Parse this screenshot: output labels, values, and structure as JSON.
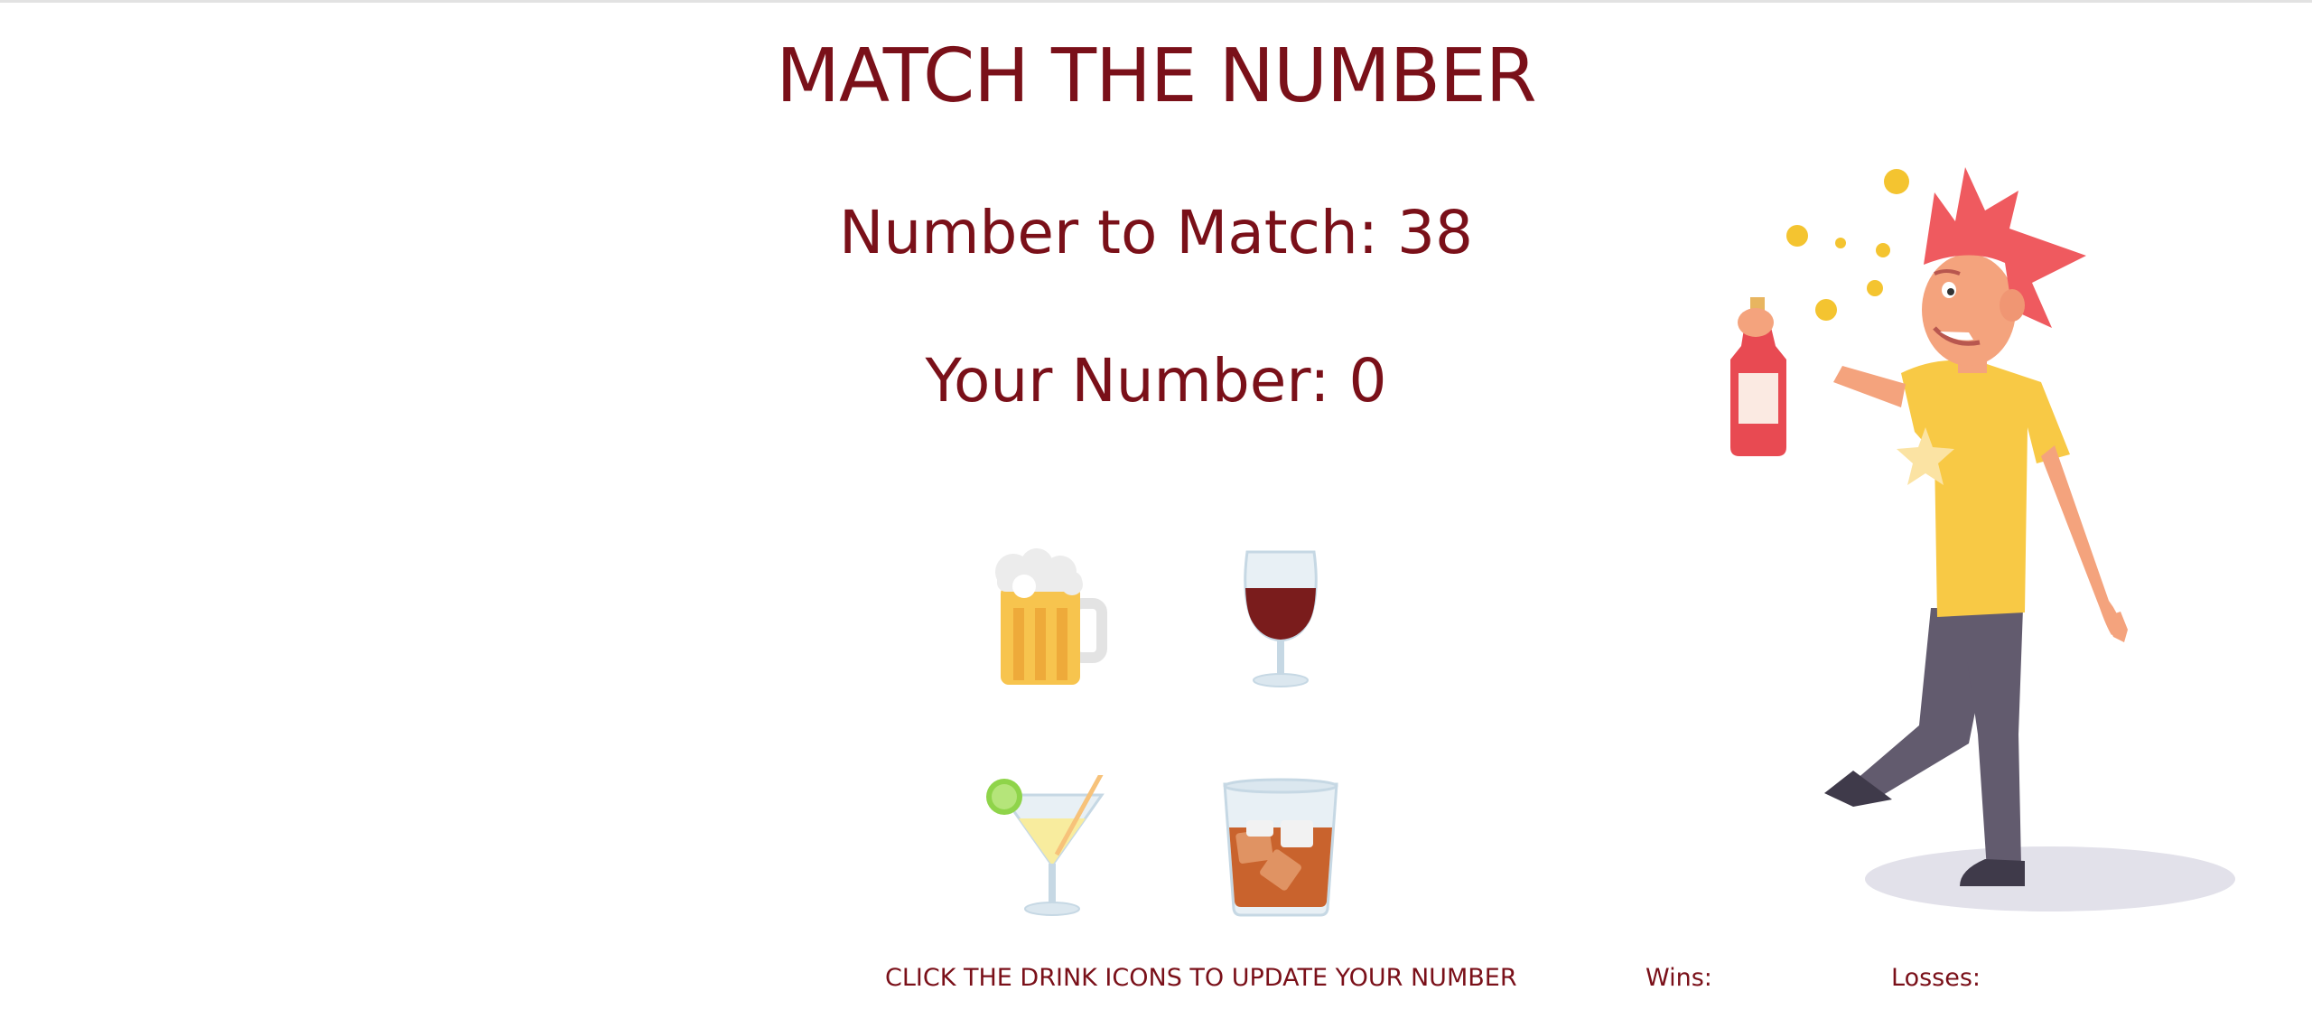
{
  "game": {
    "title": "MATCH THE NUMBER",
    "target_label": "Number to Match: 38",
    "target_number": 38,
    "your_label": "Your Number: 0",
    "your_number": 0,
    "instructions": "CLICK THE DRINK ICONS TO UPDATE YOUR NUMBER",
    "wins_label": "Wins:",
    "wins_value": "",
    "losses_label": "Losses:",
    "losses_value": ""
  },
  "drinks": [
    {
      "name": "beer",
      "icon": "beer-mug-icon"
    },
    {
      "name": "wine",
      "icon": "wine-glass-icon"
    },
    {
      "name": "cocktail",
      "icon": "cocktail-icon"
    },
    {
      "name": "whiskey",
      "icon": "whiskey-glass-icon"
    }
  ],
  "colors": {
    "text": "#7a1019",
    "beer": "#f7c44e",
    "wine": "#7a1c1c",
    "whiskey": "#c9632d",
    "lime": "#8fd44a",
    "shirt": "#f8c945",
    "hair": "#ef5a5f",
    "pants": "#625b6e"
  },
  "illustration": {
    "name": "drunk-man-illustration"
  }
}
